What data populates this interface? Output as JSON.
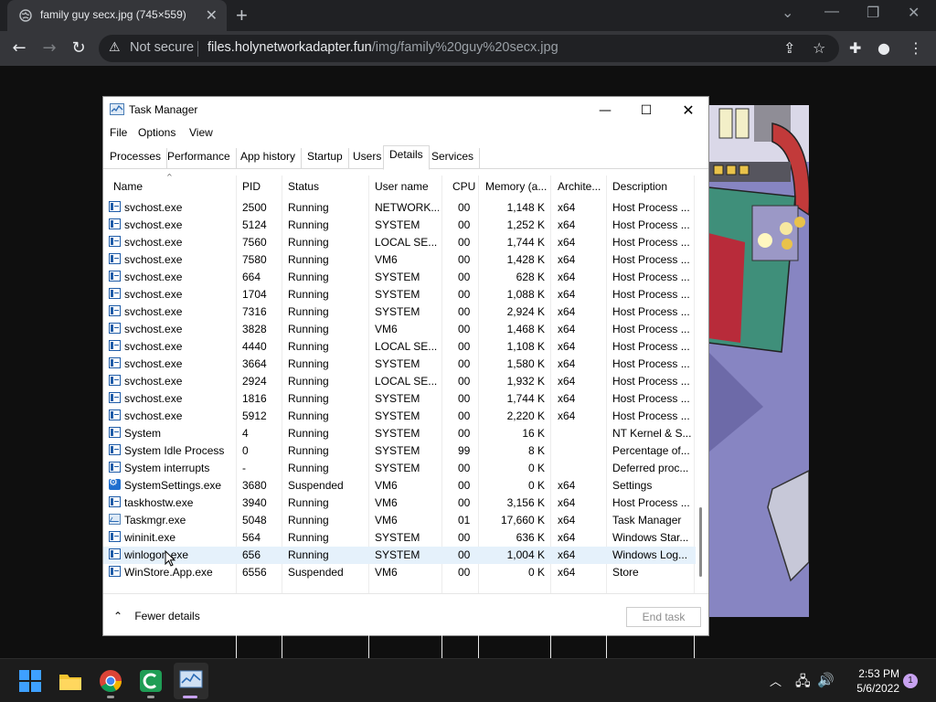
{
  "browser": {
    "tab_title": "family guy secx.jpg (745×559)",
    "security_label": "Not secure",
    "url_host": "files.holynetworkadapter.fun",
    "url_path": "/img/family%20guy%20secx.jpg"
  },
  "taskmanager": {
    "title": "Task Manager",
    "menu": [
      "File",
      "Options",
      "View"
    ],
    "tabs": [
      "Processes",
      "Performance",
      "App history",
      "Startup",
      "Users",
      "Details",
      "Services"
    ],
    "active_tab": "Details",
    "columns": [
      "Name",
      "PID",
      "Status",
      "User name",
      "CPU",
      "Memory (a...",
      "Archite...",
      "Description"
    ],
    "rows": [
      {
        "name": "svchost.exe",
        "pid": "2500",
        "status": "Running",
        "user": "NETWORK...",
        "cpu": "00",
        "mem": "1,148 K",
        "arch": "x64",
        "desc": "Host Process ...",
        "icon": "svc"
      },
      {
        "name": "svchost.exe",
        "pid": "5124",
        "status": "Running",
        "user": "SYSTEM",
        "cpu": "00",
        "mem": "1,252 K",
        "arch": "x64",
        "desc": "Host Process ...",
        "icon": "svc"
      },
      {
        "name": "svchost.exe",
        "pid": "7560",
        "status": "Running",
        "user": "LOCAL SE...",
        "cpu": "00",
        "mem": "1,744 K",
        "arch": "x64",
        "desc": "Host Process ...",
        "icon": "svc"
      },
      {
        "name": "svchost.exe",
        "pid": "7580",
        "status": "Running",
        "user": "VM6",
        "cpu": "00",
        "mem": "1,428 K",
        "arch": "x64",
        "desc": "Host Process ...",
        "icon": "svc"
      },
      {
        "name": "svchost.exe",
        "pid": "664",
        "status": "Running",
        "user": "SYSTEM",
        "cpu": "00",
        "mem": "628 K",
        "arch": "x64",
        "desc": "Host Process ...",
        "icon": "svc"
      },
      {
        "name": "svchost.exe",
        "pid": "1704",
        "status": "Running",
        "user": "SYSTEM",
        "cpu": "00",
        "mem": "1,088 K",
        "arch": "x64",
        "desc": "Host Process ...",
        "icon": "svc"
      },
      {
        "name": "svchost.exe",
        "pid": "7316",
        "status": "Running",
        "user": "SYSTEM",
        "cpu": "00",
        "mem": "2,924 K",
        "arch": "x64",
        "desc": "Host Process ...",
        "icon": "svc"
      },
      {
        "name": "svchost.exe",
        "pid": "3828",
        "status": "Running",
        "user": "VM6",
        "cpu": "00",
        "mem": "1,468 K",
        "arch": "x64",
        "desc": "Host Process ...",
        "icon": "svc"
      },
      {
        "name": "svchost.exe",
        "pid": "4440",
        "status": "Running",
        "user": "LOCAL SE...",
        "cpu": "00",
        "mem": "1,108 K",
        "arch": "x64",
        "desc": "Host Process ...",
        "icon": "svc"
      },
      {
        "name": "svchost.exe",
        "pid": "3664",
        "status": "Running",
        "user": "SYSTEM",
        "cpu": "00",
        "mem": "1,580 K",
        "arch": "x64",
        "desc": "Host Process ...",
        "icon": "svc"
      },
      {
        "name": "svchost.exe",
        "pid": "2924",
        "status": "Running",
        "user": "LOCAL SE...",
        "cpu": "00",
        "mem": "1,932 K",
        "arch": "x64",
        "desc": "Host Process ...",
        "icon": "svc"
      },
      {
        "name": "svchost.exe",
        "pid": "1816",
        "status": "Running",
        "user": "SYSTEM",
        "cpu": "00",
        "mem": "1,744 K",
        "arch": "x64",
        "desc": "Host Process ...",
        "icon": "svc"
      },
      {
        "name": "svchost.exe",
        "pid": "5912",
        "status": "Running",
        "user": "SYSTEM",
        "cpu": "00",
        "mem": "2,220 K",
        "arch": "x64",
        "desc": "Host Process ...",
        "icon": "svc"
      },
      {
        "name": "System",
        "pid": "4",
        "status": "Running",
        "user": "SYSTEM",
        "cpu": "00",
        "mem": "16 K",
        "arch": "",
        "desc": "NT Kernel & S...",
        "icon": "svc"
      },
      {
        "name": "System Idle Process",
        "pid": "0",
        "status": "Running",
        "user": "SYSTEM",
        "cpu": "99",
        "mem": "8 K",
        "arch": "",
        "desc": "Percentage of...",
        "icon": "svc"
      },
      {
        "name": "System interrupts",
        "pid": "-",
        "status": "Running",
        "user": "SYSTEM",
        "cpu": "00",
        "mem": "0 K",
        "arch": "",
        "desc": "Deferred proc...",
        "icon": "svc"
      },
      {
        "name": "SystemSettings.exe",
        "pid": "3680",
        "status": "Suspended",
        "user": "VM6",
        "cpu": "00",
        "mem": "0 K",
        "arch": "x64",
        "desc": "Settings",
        "icon": "gear"
      },
      {
        "name": "taskhostw.exe",
        "pid": "3940",
        "status": "Running",
        "user": "VM6",
        "cpu": "00",
        "mem": "3,156 K",
        "arch": "x64",
        "desc": "Host Process ...",
        "icon": "svc"
      },
      {
        "name": "Taskmgr.exe",
        "pid": "5048",
        "status": "Running",
        "user": "VM6",
        "cpu": "01",
        "mem": "17,660 K",
        "arch": "x64",
        "desc": "Task Manager",
        "icon": "tm"
      },
      {
        "name": "wininit.exe",
        "pid": "564",
        "status": "Running",
        "user": "SYSTEM",
        "cpu": "00",
        "mem": "636 K",
        "arch": "x64",
        "desc": "Windows Star...",
        "icon": "svc"
      },
      {
        "name": "winlogon.exe",
        "pid": "656",
        "status": "Running",
        "user": "SYSTEM",
        "cpu": "00",
        "mem": "1,004 K",
        "arch": "x64",
        "desc": "Windows Log...",
        "icon": "svc",
        "highlight": true
      },
      {
        "name": "WinStore.App.exe",
        "pid": "6556",
        "status": "Suspended",
        "user": "VM6",
        "cpu": "00",
        "mem": "0 K",
        "arch": "x64",
        "desc": "Store",
        "icon": "svc"
      }
    ],
    "fewer_details": "Fewer details",
    "end_task": "End task"
  },
  "taskbar": {
    "time": "2:53 PM",
    "date": "5/6/2022",
    "notification_count": "1"
  }
}
